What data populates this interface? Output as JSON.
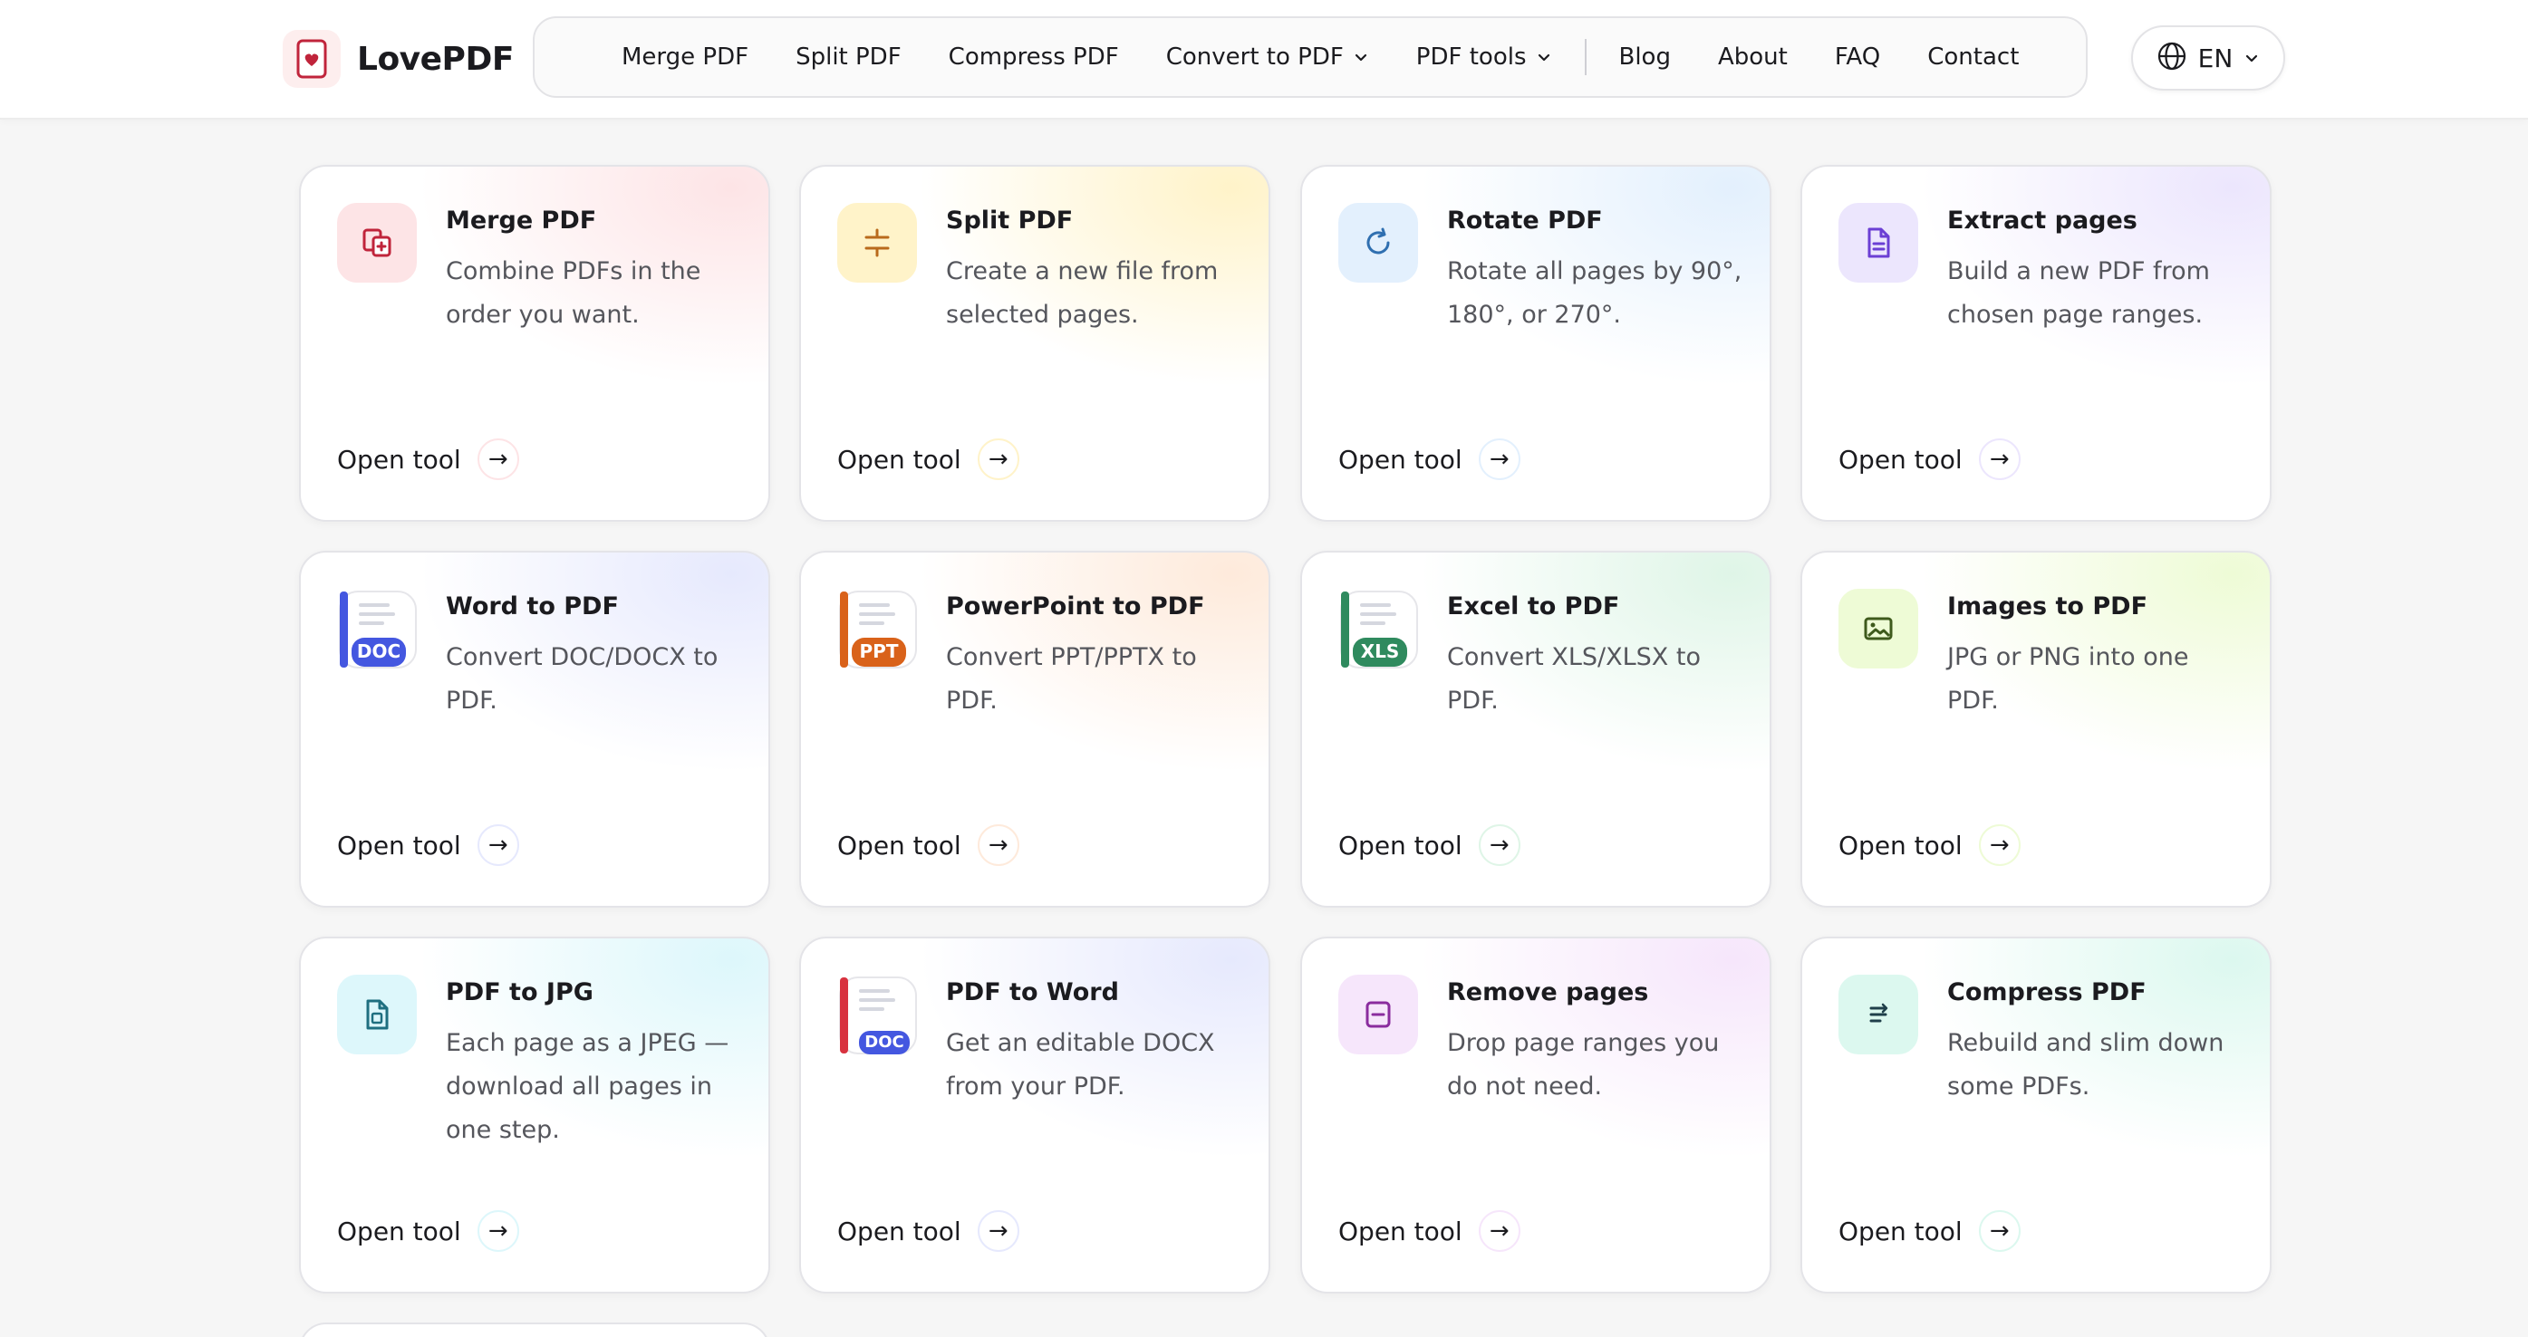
{
  "brand": {
    "name": "LovePDF"
  },
  "nav": {
    "items": [
      {
        "label": "Merge PDF"
      },
      {
        "label": "Split PDF"
      },
      {
        "label": "Compress PDF"
      },
      {
        "label": "Convert to PDF"
      },
      {
        "label": "PDF tools"
      },
      {
        "label": "Blog"
      },
      {
        "label": "About"
      },
      {
        "label": "FAQ"
      },
      {
        "label": "Contact"
      }
    ]
  },
  "language": {
    "label": "EN"
  },
  "cards": [
    {
      "title": "Merge PDF",
      "desc": "Combine PDFs in the order you want.",
      "cta": "Open tool",
      "icon": "merge-icon",
      "accent": "#c0243b",
      "tint": "#fde4e6"
    },
    {
      "title": "Split PDF",
      "desc": "Create a new file from selected pages.",
      "cta": "Open tool",
      "icon": "split-icon",
      "accent": "#b96a1c",
      "tint": "#fff3c9"
    },
    {
      "title": "Rotate PDF",
      "desc": "Rotate all pages by 90°, 180°, or 270°.",
      "cta": "Open tool",
      "icon": "rotate-icon",
      "accent": "#2f6fb0",
      "tint": "#e3f0fd"
    },
    {
      "title": "Extract pages",
      "desc": "Build a new PDF from chosen page ranges.",
      "cta": "Open tool",
      "icon": "extract-icon",
      "accent": "#6b3fd4",
      "tint": "#ece6fd"
    },
    {
      "title": "Word to PDF",
      "desc": "Convert DOC/DOCX to PDF.",
      "cta": "Open tool",
      "icon": "doc-file-icon",
      "badge": "DOC",
      "accent": "#4457e0",
      "tint": "#e6e9fd"
    },
    {
      "title": "PowerPoint to PDF",
      "desc": "Convert PPT/PPTX to PDF.",
      "cta": "Open tool",
      "icon": "ppt-file-icon",
      "badge": "PPT",
      "accent": "#d9621a",
      "tint": "#feeadb"
    },
    {
      "title": "Excel to PDF",
      "desc": "Convert XLS/XLSX to PDF.",
      "cta": "Open tool",
      "icon": "xls-file-icon",
      "badge": "XLS",
      "accent": "#2f8a5e",
      "tint": "#dff5e7"
    },
    {
      "title": "Images to PDF",
      "desc": "JPG or PNG into one PDF.",
      "cta": "Open tool",
      "icon": "image-icon",
      "accent": "#3e5a1c",
      "tint": "#eefbd6"
    },
    {
      "title": "PDF to JPG",
      "desc": "Each page as a JPEG — download all pages in one step.",
      "cta": "Open tool",
      "icon": "jpg-file-icon",
      "accent": "#1f6f80",
      "tint": "#ddf7fb"
    },
    {
      "title": "PDF to Word",
      "desc": "Get an editable DOCX from your PDF.",
      "cta": "Open tool",
      "icon": "pdf-doc-file-icon",
      "badge": "DOC",
      "accent": "#4457e0",
      "tint": "#e6e9fd"
    },
    {
      "title": "Remove pages",
      "desc": "Drop page ranges you do not need.",
      "cta": "Open tool",
      "icon": "remove-icon",
      "accent": "#8a2c9e",
      "tint": "#f6e6fb"
    },
    {
      "title": "Compress PDF",
      "desc": "Rebuild and slim down some PDFs.",
      "cta": "Open tool",
      "icon": "compress-icon",
      "accent": "#1f3f4a",
      "tint": "#dcf8ef"
    }
  ]
}
